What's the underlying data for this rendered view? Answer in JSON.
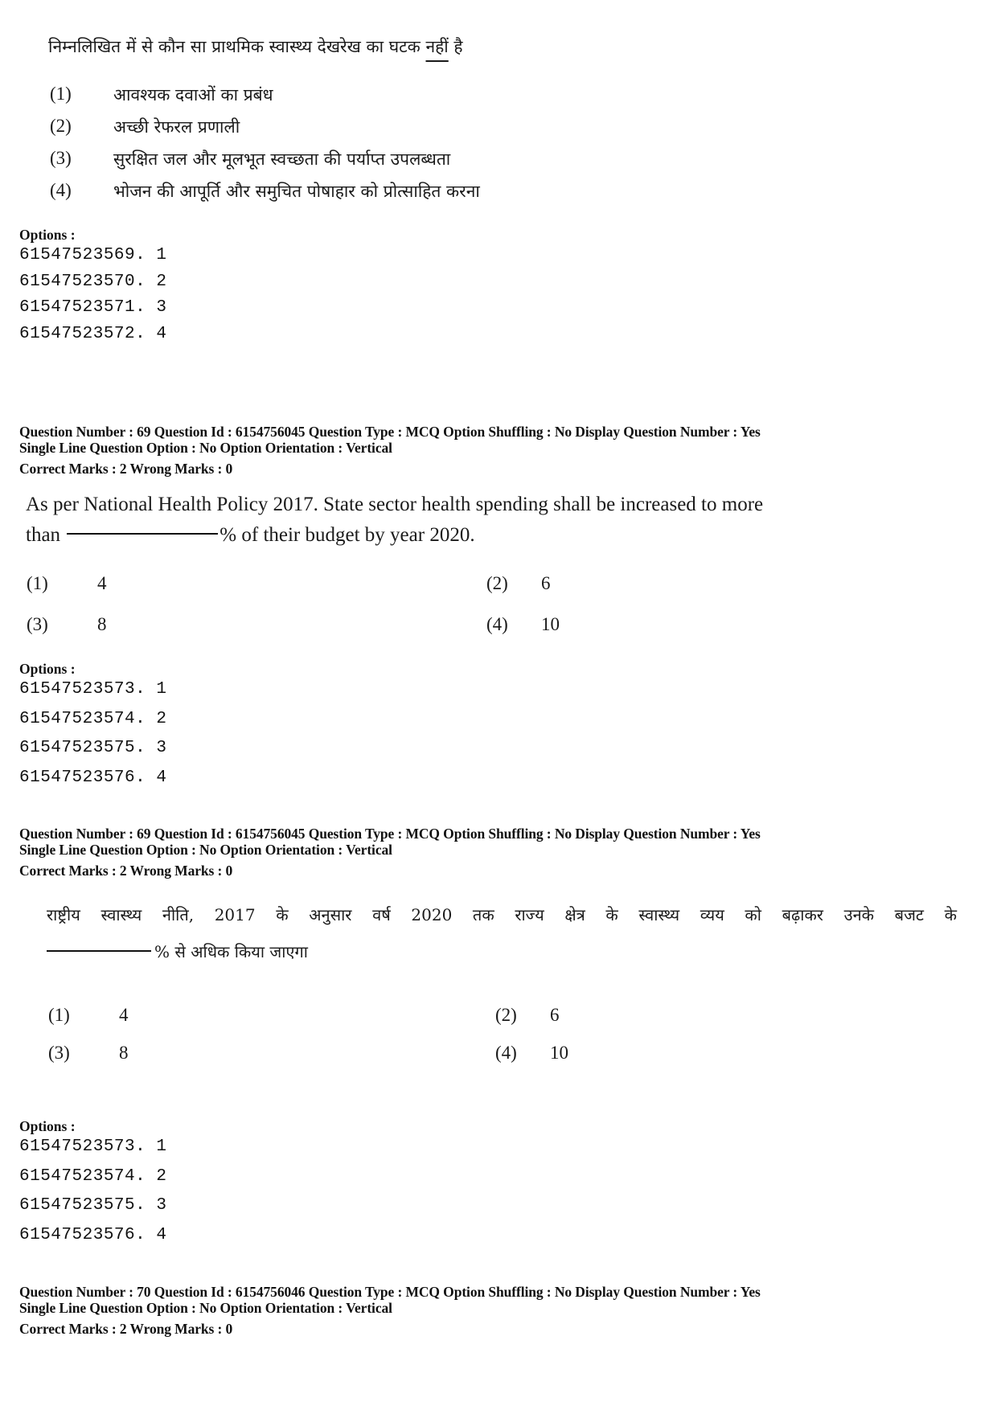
{
  "block1": {
    "question_hindi_prefix": "निम्नलिखित में से कौन सा प्राथमिक स्वास्थ्य देखरेख का घटक ",
    "question_hindi_underlined": "नहीं",
    "question_hindi_suffix": " है",
    "choices": [
      {
        "num": "(1)",
        "text": "आवश्यक दवाओं का प्रबंध"
      },
      {
        "num": "(2)",
        "text": "अच्छी रेफरल प्रणाली"
      },
      {
        "num": "(3)",
        "text": "सुरक्षित जल और मूलभूत स्वच्छता की पर्याप्त उपलब्धता"
      },
      {
        "num": "(4)",
        "text": "भोजन की आपूर्ति और समुचित पोषाहार को प्रोत्साहित करना"
      }
    ],
    "options_label": "Options :",
    "option_ids": [
      "61547523569. 1",
      "61547523570. 2",
      "61547523571. 3",
      "61547523572. 4"
    ]
  },
  "block2": {
    "meta_line1": "Question Number : 69  Question Id : 6154756045  Question Type : MCQ  Option Shuffling : No  Display Question Number : Yes",
    "meta_line2": "Single Line Question Option : No  Option Orientation : Vertical",
    "meta_line3": "Correct Marks : 2  Wrong Marks : 0",
    "question_line1": "As per National Health Policy 2017. State sector health spending shall be increased to more",
    "question_line2_prefix": "than",
    "question_line2_suffix": "% of their budget by year 2020.",
    "choices": [
      {
        "num": "(1)",
        "text": "4"
      },
      {
        "num": "(2)",
        "text": "6"
      },
      {
        "num": "(3)",
        "text": "8"
      },
      {
        "num": "(4)",
        "text": "10"
      }
    ],
    "options_label": "Options :",
    "option_ids": [
      "61547523573. 1",
      "61547523574. 2",
      "61547523575. 3",
      "61547523576. 4"
    ]
  },
  "block3": {
    "meta_line1": "Question Number : 69  Question Id : 6154756045  Question Type : MCQ  Option Shuffling : No  Display Question Number : Yes",
    "meta_line2": "Single Line Question Option : No  Option Orientation : Vertical",
    "meta_line3": "Correct Marks : 2  Wrong Marks : 0",
    "question_line1": "राष्ट्रीय स्वास्थ्य नीति, 2017 के अनुसार वर्ष 2020 तक राज्य क्षेत्र के स्वास्थ्य व्यय को बढ़ाकर उनके बजट के",
    "question_line2_suffix": "% से अधिक किया जाएगा",
    "choices": [
      {
        "num": "(1)",
        "text": "4"
      },
      {
        "num": "(2)",
        "text": "6"
      },
      {
        "num": "(3)",
        "text": "8"
      },
      {
        "num": "(4)",
        "text": "10"
      }
    ],
    "options_label": "Options :",
    "option_ids": [
      "61547523573. 1",
      "61547523574. 2",
      "61547523575. 3",
      "61547523576. 4"
    ]
  },
  "block4": {
    "meta_line1": "Question Number : 70  Question Id : 6154756046  Question Type : MCQ  Option Shuffling : No  Display Question Number : Yes",
    "meta_line2": "Single Line Question Option : No  Option Orientation : Vertical",
    "meta_line3": "Correct Marks : 2  Wrong Marks : 0"
  }
}
